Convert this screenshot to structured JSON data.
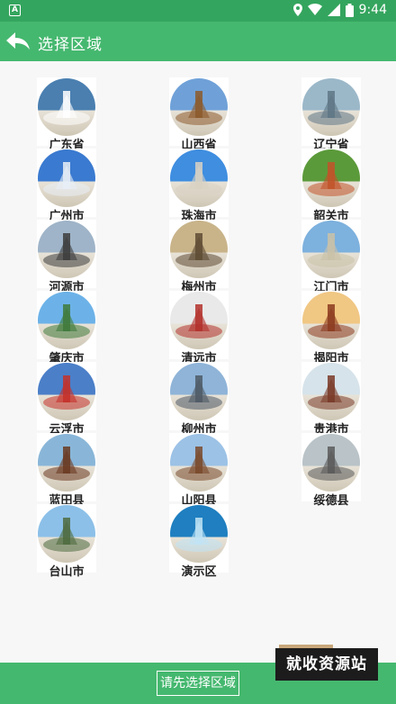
{
  "status_bar": {
    "app_badge": "A",
    "time": "9:44"
  },
  "toolbar": {
    "title": "选择区域"
  },
  "regions": [
    {
      "label": "广东省",
      "icon": "guangdong-emblem",
      "bg": "#4a7fb0",
      "fg": "#ffffff"
    },
    {
      "label": "山西省",
      "icon": "shanxi-pagoda",
      "bg": "#6fa1d8",
      "fg": "#8c5a2b"
    },
    {
      "label": "辽宁省",
      "icon": "liaoning-harbor",
      "bg": "#9bb8c9",
      "fg": "#5f7786"
    },
    {
      "label": "广州市",
      "icon": "guangzhou-tower",
      "bg": "#3a7ad0",
      "fg": "#e8eef6"
    },
    {
      "label": "珠海市",
      "icon": "zhuhai-statue",
      "bg": "#3f8ee0",
      "fg": "#d9d2c3"
    },
    {
      "label": "韶关市",
      "icon": "shaoguan-danxia",
      "bg": "#5b9a3a",
      "fg": "#c2542a"
    },
    {
      "label": "河源市",
      "icon": "heyuan-globe",
      "bg": "#9fb4c8",
      "fg": "#3d3d3d"
    },
    {
      "label": "梅州市",
      "icon": "meizhou-monument",
      "bg": "#c9b48a",
      "fg": "#5e4b33"
    },
    {
      "label": "江门市",
      "icon": "jiangmen-city",
      "bg": "#7db1de",
      "fg": "#c9c2a8"
    },
    {
      "label": "肇庆市",
      "icon": "zhaoqing-karst",
      "bg": "#6cb2e8",
      "fg": "#3f7a3a"
    },
    {
      "label": "清远市",
      "icon": "qingyuan-sculpture",
      "bg": "#e9e9e9",
      "fg": "#b3312b"
    },
    {
      "label": "揭阳市",
      "icon": "jieyang-gate",
      "bg": "#f0c783",
      "fg": "#8c3b1f"
    },
    {
      "label": "云浮市",
      "icon": "yunfu-dragon",
      "bg": "#4b7fc8",
      "fg": "#c4312a"
    },
    {
      "label": "柳州市",
      "icon": "liuzhou-skyline",
      "bg": "#8fb4d8",
      "fg": "#4e5a66"
    },
    {
      "label": "贵港市",
      "icon": "guigang-pavilion",
      "bg": "#d6e3ea",
      "fg": "#7a3a28"
    },
    {
      "label": "蓝田县",
      "icon": "lantian-temple",
      "bg": "#89b6d8",
      "fg": "#6b3b22"
    },
    {
      "label": "山阳县",
      "icon": "shanyang-tower",
      "bg": "#9cc2e6",
      "fg": "#7a4a2b"
    },
    {
      "label": "绥德县",
      "icon": "suide-archway",
      "bg": "#b9c3c8",
      "fg": "#5a5a5a"
    },
    {
      "label": "台山市",
      "icon": "taishan-tower",
      "bg": "#8cc0e8",
      "fg": "#4f6b3f"
    },
    {
      "label": "演示区",
      "icon": "demo-underwater",
      "bg": "#1f7fc0",
      "fg": "#bfe3f5"
    }
  ],
  "bottom": {
    "confirm_label": "请先选择区域"
  },
  "watermark": {
    "text": "就收资源站"
  }
}
